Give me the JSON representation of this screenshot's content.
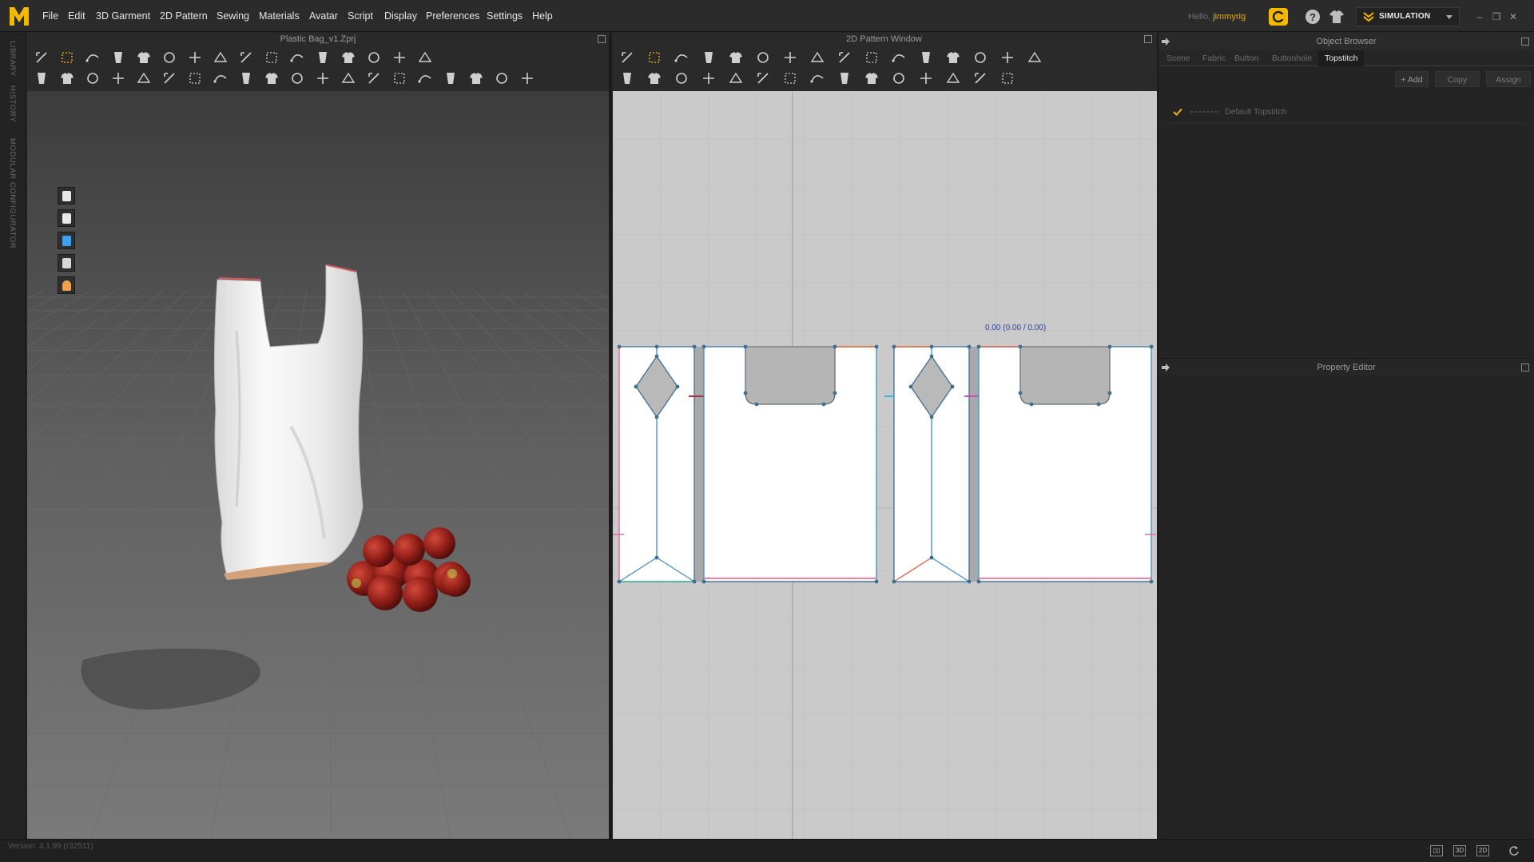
{
  "app": {
    "logo_letter": "M",
    "accent": "#f5b800",
    "menu": [
      "File",
      "Edit",
      "3D Garment",
      "2D Pattern",
      "Sewing",
      "Materials",
      "Avatar",
      "Script",
      "Display",
      "Preferences",
      "Settings",
      "Help"
    ],
    "hello_text": "Hello,",
    "username": "jimmyrig",
    "mode_label": "SIMULATION",
    "window_controls": [
      "minimize-icon",
      "restore-icon",
      "close-icon"
    ]
  },
  "left_strip": {
    "tabs": [
      "LIBRARY",
      "HISTORY",
      "MODULAR CONFIGURATOR"
    ]
  },
  "view3d": {
    "title": "Plastic Bag_v1.Zprj",
    "side_tools": [
      "garment-icon",
      "avatar-icon",
      "texture-icon",
      "mesh-icon",
      "skin-icon"
    ],
    "toolbar_row1": [
      "select-move-icon",
      "transform-pattern-icon",
      "box-select-icon",
      "bounding-select-icon",
      "brush-select-icon",
      "pin-icon",
      "tack-icon",
      "fold-icon",
      "arrange-icon",
      "shirt-icon",
      "shirt-fold-icon",
      "jacket-icon",
      "pants-icon",
      "curve-pin-icon",
      "zip-icon",
      "ruler-icon"
    ],
    "toolbar_row2": [
      "walk-icon",
      "arrange-point-icon",
      "measure-icon",
      "fit-icon",
      "fold-arrange-icon",
      "steam-icon",
      "press-icon",
      "avatar-measure-icon",
      "hanger-icon",
      "button-icon",
      "buttonhole-icon",
      "line-icon",
      "lock-icon",
      "layer-icon",
      "trim-icon",
      "cut-icon",
      "puff-icon",
      "shape-icon",
      "shirt-icon-2",
      "shirt-icon-3"
    ]
  },
  "view2d": {
    "title": "2D Pattern Window",
    "measurement": "0.00 (0.00 / 0.00)",
    "toolbar_row1": [
      "edit-pattern-icon",
      "edit-point-icon",
      "curve-point-icon",
      "edit-curvature-icon",
      "add-point-icon",
      "create-internal-icon",
      "polygon-icon",
      "rectangle-icon",
      "circle-icon",
      "dart-icon",
      "rect-internal-icon",
      "circle-internal-icon",
      "internal-dart-icon",
      "layer-clone-icon",
      "tuck-icon",
      "fold-pattern-icon"
    ],
    "toolbar_row2": [
      "sew-segment-icon",
      "sew-free-icon",
      "sew-m-n-icon",
      "check-sewing-icon",
      "tack-sew-icon",
      "iron-icon",
      "fabric-icon",
      "trace-icon",
      "puckering-icon",
      "graphic-icon",
      "texture-adjust-icon",
      "topstitch-icon",
      "segment-topstitch-icon",
      "free-topstitch-icon",
      "edit-topstitch-icon"
    ]
  },
  "object_browser": {
    "title": "Object Browser",
    "tabs": [
      "Scene",
      "Fabric",
      "Button",
      "Buttonhole",
      "Topstitch"
    ],
    "active_tab": "Topstitch",
    "buttons": [
      "+ Add",
      "Copy",
      "Assign"
    ],
    "items": [
      {
        "label": "Default Topstitch",
        "checked": true
      }
    ]
  },
  "property_editor": {
    "title": "Property Editor"
  },
  "status": {
    "version": "Version: 4.1.99 (r32511)",
    "view_modes": [
      "split-view-icon",
      "3D",
      "2D"
    ],
    "refresh_icon": "refresh-icon"
  }
}
